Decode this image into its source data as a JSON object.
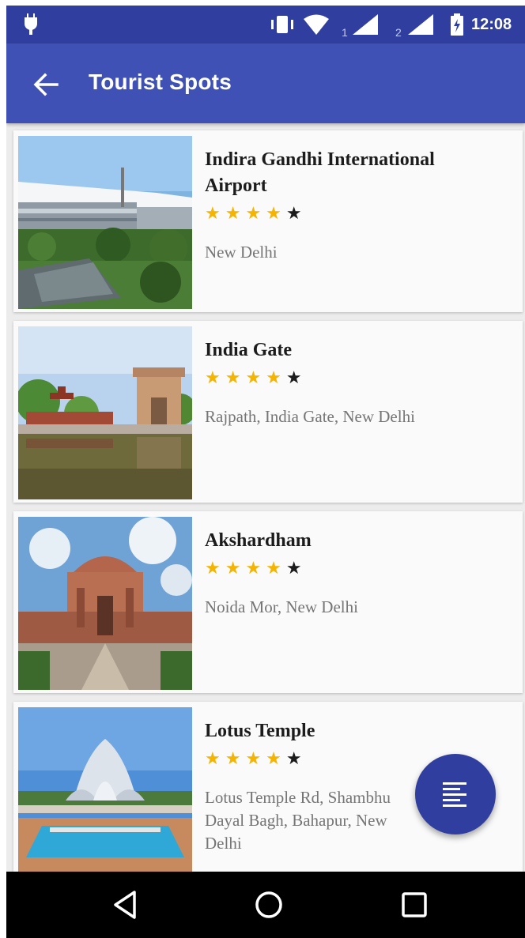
{
  "status_bar": {
    "time": "12:08",
    "sim1_label": "1",
    "sim2_label": "2",
    "icons": [
      "android-debug-icon",
      "vibrate-icon",
      "wifi-icon",
      "signal-icon",
      "signal-icon",
      "battery-icon"
    ]
  },
  "toolbar": {
    "title": "Tourist Spots",
    "back_icon": "arrow-back-icon"
  },
  "spots": [
    {
      "name": "Indira Gandhi International Airport",
      "rating": 4.5,
      "location": "New Delhi"
    },
    {
      "name": "India Gate",
      "rating": 4.5,
      "location": "Rajpath, India Gate, New Delhi"
    },
    {
      "name": "Akshardham",
      "rating": 4.5,
      "location": "Noida Mor, New Delhi"
    },
    {
      "name": "Lotus Temple",
      "rating": 4.5,
      "location": "Lotus Temple Rd, Shambhu Dayal Bagh, Bahapur, New Delhi"
    }
  ],
  "fab": {
    "icon": "list-icon"
  },
  "nav_bar": {
    "icons": [
      "back-triangle-icon",
      "home-circle-icon",
      "recents-square-icon"
    ]
  },
  "colors": {
    "primary": "#3f51b5",
    "primary_dark": "#303f9f",
    "star": "#f4b400"
  }
}
